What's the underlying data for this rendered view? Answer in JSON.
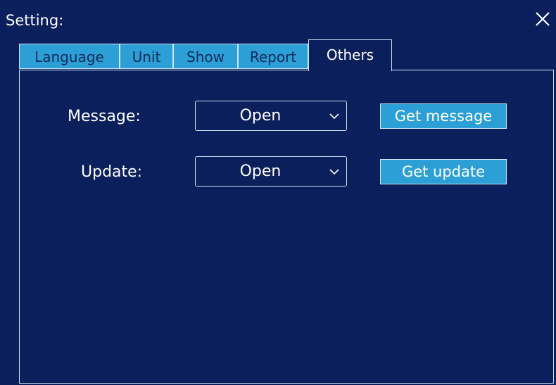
{
  "window": {
    "title": "Setting:",
    "close_icon": "close-icon"
  },
  "tabs": [
    {
      "label": "Language",
      "active": false
    },
    {
      "label": "Unit",
      "active": false
    },
    {
      "label": "Show",
      "active": false
    },
    {
      "label": "Report",
      "active": false
    },
    {
      "label": "Others",
      "active": true
    }
  ],
  "others": {
    "message": {
      "label": "Message:",
      "value": "Open",
      "button_label": "Get message"
    },
    "update": {
      "label": "Update:",
      "value": "Open",
      "button_label": "Get update"
    }
  },
  "colors": {
    "background": "#0a1f5c",
    "accent": "#2b9fd6",
    "border": "#cfe6f5",
    "text": "#ffffff"
  }
}
